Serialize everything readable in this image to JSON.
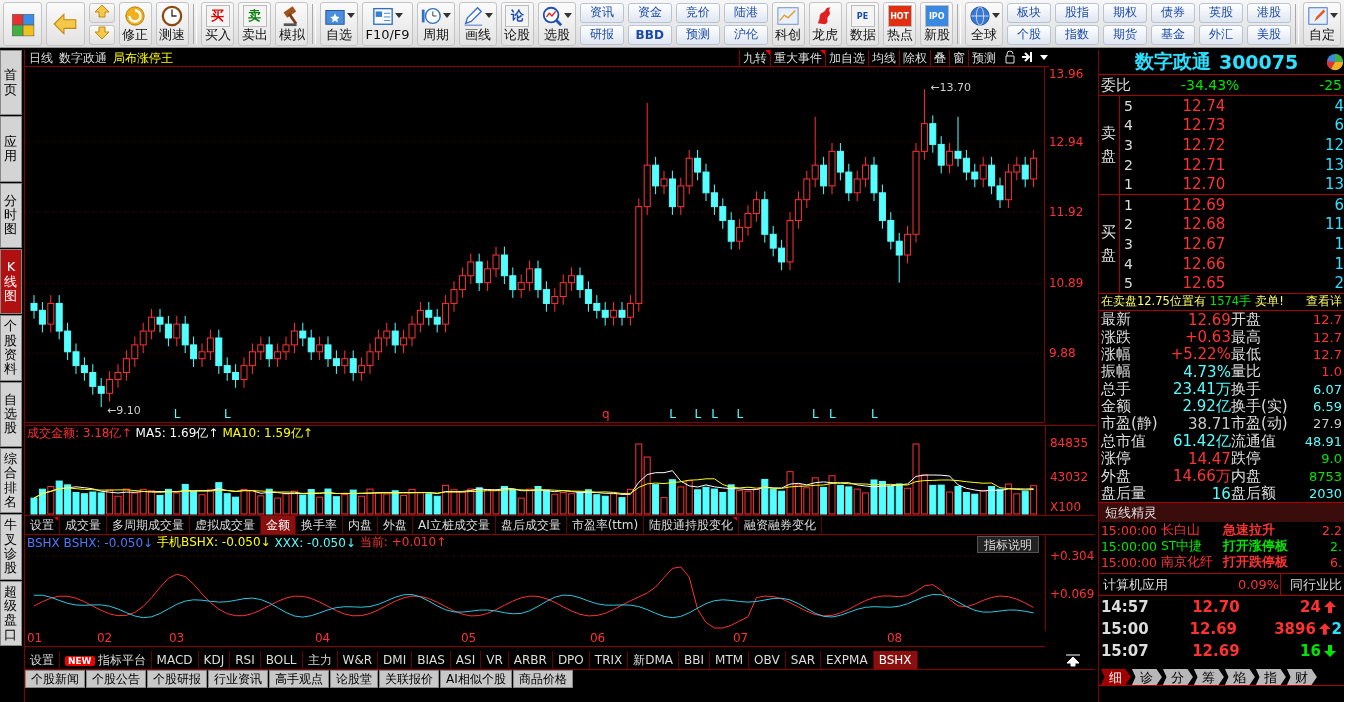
{
  "toolbar": [
    {
      "kind": "big",
      "dropdown": false
    },
    {
      "kind": "big",
      "dropdown": false
    },
    {
      "kind": "updown"
    },
    {
      "kind": "big",
      "label": "修正",
      "dropdown": false
    },
    {
      "kind": "big",
      "label": "测速",
      "dropdown": false
    },
    {
      "kind": "sep"
    },
    {
      "kind": "big",
      "label": "买入",
      "glyph": "买",
      "dropdown": false
    },
    {
      "kind": "big",
      "label": "卖出",
      "glyph": "卖",
      "dropdown": false
    },
    {
      "kind": "big",
      "label": "模拟",
      "dropdown": false
    },
    {
      "kind": "sep"
    },
    {
      "kind": "big",
      "label": "自选",
      "dropdown": true
    },
    {
      "kind": "big",
      "label": "F10/F9",
      "dropdown": true
    },
    {
      "kind": "big",
      "label": "周期",
      "dropdown": true
    },
    {
      "kind": "big",
      "label": "画线",
      "dropdown": true
    },
    {
      "kind": "big",
      "label": "论股",
      "glyph": "论",
      "dropdown": false
    },
    {
      "kind": "big",
      "label": "选股",
      "dropdown": true
    },
    {
      "kind": "pair",
      "top": "资讯",
      "bottom": "研报"
    },
    {
      "kind": "pair",
      "top": "资金",
      "bottom": "BBD"
    },
    {
      "kind": "pair",
      "top": "竞价",
      "bottom": "预测"
    },
    {
      "kind": "pair",
      "top": "陆港",
      "bottom": "沪伦"
    },
    {
      "kind": "big",
      "label": "科创",
      "dropdown": false
    },
    {
      "kind": "big",
      "label": "龙虎",
      "dropdown": false
    },
    {
      "kind": "big",
      "label": "数据",
      "glyph": "PE",
      "dropdown": false
    },
    {
      "kind": "big",
      "label": "热点",
      "glyph": "HOT",
      "dropdown": false
    },
    {
      "kind": "big",
      "label": "新股",
      "glyph": "IPO",
      "dropdown": false
    },
    {
      "kind": "sep"
    },
    {
      "kind": "big",
      "label": "全球",
      "dropdown": true
    },
    {
      "kind": "pair",
      "top": "板块",
      "bottom": "个股"
    },
    {
      "kind": "pair",
      "top": "股指",
      "bottom": "指数"
    },
    {
      "kind": "pair",
      "top": "期权",
      "bottom": "期货"
    },
    {
      "kind": "pair",
      "top": "债券",
      "bottom": "基金"
    },
    {
      "kind": "pair",
      "top": "英股",
      "bottom": "外汇"
    },
    {
      "kind": "pair",
      "top": "港股",
      "bottom": "美股"
    },
    {
      "kind": "sep"
    },
    {
      "kind": "big",
      "label": "自定",
      "dropdown": true
    }
  ],
  "side_tabs": [
    {
      "label": "首页",
      "selected": false
    },
    {
      "label": "应用",
      "selected": false
    },
    {
      "label": "分时图",
      "selected": false
    },
    {
      "label": "K线图",
      "selected": true
    },
    {
      "label": "个股资料",
      "selected": false
    },
    {
      "label": "自选股",
      "selected": false
    },
    {
      "label": "综合排名",
      "selected": false
    },
    {
      "label": "牛叉诊股",
      "selected": false
    },
    {
      "label": "超级盘口",
      "selected": false
    }
  ],
  "chart_header": {
    "period": "日线",
    "stock": "数字政通",
    "strategy": "局布涨停王",
    "buttons": [
      {
        "label": "九转",
        "flag": true
      },
      {
        "label": "重大事件",
        "flag": true
      },
      {
        "label": "加自选",
        "flag": false
      },
      {
        "label": "均线",
        "flag": false
      },
      {
        "label": "除权",
        "flag": false
      },
      {
        "label": "叠",
        "flag": false
      },
      {
        "label": "窗",
        "flag": false
      },
      {
        "label": "预测",
        "flag": false
      }
    ]
  },
  "kline": {
    "chart_data": {
      "type": "candlestick",
      "ylim": [
        8.87,
        14.02
      ],
      "grid": true,
      "yticks": [
        13.96,
        12.94,
        11.92,
        10.89,
        9.88
      ],
      "ohlc": [
        [
          10.6,
          10.72,
          10.38,
          10.5
        ],
        [
          10.5,
          10.62,
          10.18,
          10.3
        ],
        [
          10.3,
          10.72,
          10.18,
          10.6
        ],
        [
          10.6,
          10.72,
          10.08,
          10.2
        ],
        [
          10.2,
          10.32,
          9.78,
          9.9
        ],
        [
          9.9,
          10.02,
          9.58,
          9.7
        ],
        [
          9.7,
          9.82,
          9.48,
          9.6
        ],
        [
          9.6,
          9.72,
          9.28,
          9.4
        ],
        [
          9.4,
          9.52,
          9.1,
          9.3
        ],
        [
          9.3,
          9.62,
          9.18,
          9.5
        ],
        [
          9.5,
          9.72,
          9.38,
          9.6
        ],
        [
          9.6,
          9.92,
          9.48,
          9.8
        ],
        [
          9.8,
          10.12,
          9.68,
          10.0
        ],
        [
          10.0,
          10.32,
          9.88,
          10.2
        ],
        [
          10.2,
          10.52,
          10.08,
          10.4
        ],
        [
          10.4,
          10.52,
          10.18,
          10.3
        ],
        [
          10.3,
          10.42,
          9.98,
          10.1
        ],
        [
          10.1,
          10.42,
          9.98,
          10.3
        ],
        [
          10.3,
          10.42,
          9.88,
          10.0
        ],
        [
          10.0,
          10.12,
          9.68,
          9.8
        ],
        [
          9.8,
          10.02,
          9.68,
          9.9
        ],
        [
          9.9,
          10.22,
          9.78,
          10.1
        ],
        [
          10.1,
          10.22,
          9.58,
          9.7
        ],
        [
          9.7,
          9.82,
          9.48,
          9.6
        ],
        [
          9.6,
          9.72,
          9.38,
          9.5
        ],
        [
          9.5,
          9.82,
          9.38,
          9.7
        ],
        [
          9.7,
          10.02,
          9.58,
          9.9
        ],
        [
          9.9,
          10.12,
          9.78,
          10.0
        ],
        [
          10.0,
          10.12,
          9.68,
          9.8
        ],
        [
          9.8,
          10.02,
          9.68,
          9.9
        ],
        [
          9.9,
          10.12,
          9.78,
          10.0
        ],
        [
          10.0,
          10.32,
          9.88,
          10.2
        ],
        [
          10.2,
          10.32,
          9.98,
          10.1
        ],
        [
          10.1,
          10.22,
          9.78,
          9.9
        ],
        [
          9.9,
          10.12,
          9.78,
          10.0
        ],
        [
          10.0,
          10.12,
          9.68,
          9.8
        ],
        [
          9.8,
          9.92,
          9.58,
          9.7
        ],
        [
          9.7,
          9.92,
          9.58,
          9.8
        ],
        [
          9.8,
          9.92,
          9.48,
          9.6
        ],
        [
          9.6,
          9.82,
          9.48,
          9.7
        ],
        [
          9.7,
          10.02,
          9.58,
          9.9
        ],
        [
          9.9,
          10.22,
          9.78,
          10.1
        ],
        [
          10.1,
          10.32,
          9.98,
          10.2
        ],
        [
          10.2,
          10.32,
          9.88,
          10.0
        ],
        [
          10.0,
          10.22,
          9.88,
          10.1
        ],
        [
          10.1,
          10.42,
          9.98,
          10.3
        ],
        [
          10.3,
          10.62,
          10.18,
          10.5
        ],
        [
          10.5,
          10.62,
          10.28,
          10.4
        ],
        [
          10.4,
          10.52,
          10.18,
          10.3
        ],
        [
          10.3,
          10.72,
          10.18,
          10.6
        ],
        [
          10.6,
          10.92,
          10.48,
          10.8
        ],
        [
          10.8,
          11.12,
          10.68,
          11.0
        ],
        [
          11.0,
          11.32,
          10.88,
          11.2
        ],
        [
          11.2,
          11.32,
          10.78,
          10.9
        ],
        [
          10.9,
          11.22,
          10.78,
          11.1
        ],
        [
          11.1,
          11.42,
          10.98,
          11.3
        ],
        [
          11.3,
          11.42,
          10.88,
          11.0
        ],
        [
          11.0,
          11.12,
          10.68,
          10.8
        ],
        [
          10.8,
          11.02,
          10.68,
          10.9
        ],
        [
          10.9,
          11.22,
          10.78,
          11.1
        ],
        [
          11.1,
          11.22,
          10.68,
          10.8
        ],
        [
          10.8,
          10.92,
          10.48,
          10.6
        ],
        [
          10.6,
          10.82,
          10.48,
          10.7
        ],
        [
          10.7,
          11.02,
          10.58,
          10.9
        ],
        [
          10.9,
          11.12,
          10.78,
          11.0
        ],
        [
          11.0,
          11.12,
          10.68,
          10.8
        ],
        [
          10.8,
          10.92,
          10.48,
          10.6
        ],
        [
          10.6,
          10.72,
          10.38,
          10.5
        ],
        [
          10.5,
          10.62,
          10.28,
          10.4
        ],
        [
          10.4,
          10.62,
          10.28,
          10.5
        ],
        [
          10.5,
          10.62,
          10.28,
          10.4
        ],
        [
          10.4,
          10.72,
          10.28,
          10.6
        ],
        [
          10.6,
          12.12,
          10.48,
          12.0
        ],
        [
          12.0,
          13.5,
          11.88,
          12.6
        ],
        [
          12.6,
          12.72,
          12.18,
          12.3
        ],
        [
          12.3,
          12.52,
          12.18,
          12.4
        ],
        [
          12.4,
          12.52,
          11.88,
          12.0
        ],
        [
          12.0,
          12.42,
          11.88,
          12.3
        ],
        [
          12.3,
          12.82,
          12.18,
          12.7
        ],
        [
          12.7,
          12.82,
          12.38,
          12.5
        ],
        [
          12.5,
          12.62,
          12.08,
          12.2
        ],
        [
          12.2,
          12.32,
          11.88,
          12.0
        ],
        [
          12.0,
          12.12,
          11.68,
          11.8
        ],
        [
          11.8,
          11.92,
          11.38,
          11.5
        ],
        [
          11.5,
          11.82,
          11.38,
          11.7
        ],
        [
          11.7,
          12.02,
          11.58,
          11.9
        ],
        [
          11.9,
          12.22,
          11.78,
          12.1
        ],
        [
          12.1,
          12.22,
          11.48,
          11.6
        ],
        [
          11.6,
          11.72,
          11.28,
          11.4
        ],
        [
          11.4,
          11.52,
          11.08,
          11.2
        ],
        [
          11.2,
          11.92,
          11.08,
          11.8
        ],
        [
          11.8,
          12.22,
          11.68,
          12.1
        ],
        [
          12.1,
          12.52,
          11.98,
          12.4
        ],
        [
          12.4,
          13.3,
          12.28,
          12.6
        ],
        [
          12.6,
          12.72,
          12.18,
          12.3
        ],
        [
          12.3,
          12.92,
          12.18,
          12.8
        ],
        [
          12.8,
          12.92,
          12.38,
          12.5
        ],
        [
          12.5,
          12.62,
          12.08,
          12.2
        ],
        [
          12.2,
          12.52,
          12.08,
          12.4
        ],
        [
          12.4,
          12.72,
          12.28,
          12.6
        ],
        [
          12.6,
          12.72,
          12.08,
          12.2
        ],
        [
          12.2,
          12.32,
          11.68,
          11.8
        ],
        [
          11.8,
          11.92,
          11.38,
          11.5
        ],
        [
          11.5,
          11.62,
          10.9,
          11.3
        ],
        [
          11.3,
          11.72,
          11.18,
          11.6
        ],
        [
          11.6,
          12.92,
          11.48,
          12.8
        ],
        [
          12.8,
          13.7,
          12.68,
          13.2
        ],
        [
          13.2,
          13.32,
          12.78,
          12.9
        ],
        [
          12.9,
          13.02,
          12.48,
          12.6
        ],
        [
          12.6,
          12.92,
          12.48,
          12.8
        ],
        [
          12.8,
          13.3,
          12.58,
          12.7
        ],
        [
          12.7,
          12.82,
          12.38,
          12.5
        ],
        [
          12.5,
          12.62,
          12.28,
          12.4
        ],
        [
          12.4,
          12.72,
          12.28,
          12.6
        ],
        [
          12.6,
          12.72,
          12.18,
          12.3
        ],
        [
          12.3,
          12.42,
          11.98,
          12.1
        ],
        [
          12.1,
          12.62,
          11.98,
          12.5
        ],
        [
          12.5,
          12.72,
          12.38,
          12.6
        ],
        [
          12.6,
          12.72,
          12.28,
          12.4
        ],
        [
          12.4,
          12.82,
          12.28,
          12.7
        ]
      ]
    },
    "high_label": "←13.70",
    "low_label": "←9.10",
    "signals": [
      "L",
      "L",
      "q",
      "L",
      "L",
      "L",
      "L",
      "L",
      "L",
      "L"
    ]
  },
  "volume": {
    "legend": [
      {
        "text": "成交金额: 3.18亿↑",
        "color": "#ff3232"
      },
      {
        "text": "MA5: 1.69亿↑",
        "color": "#ffffff"
      },
      {
        "text": "MA10: 1.59亿↑",
        "color": "#ffff00"
      }
    ],
    "ticks": [
      "84835",
      "43032",
      "X100"
    ]
  },
  "volume_tabs": [
    {
      "label": "设置",
      "flag": true,
      "selected": false
    },
    {
      "label": "成交量",
      "flag": false,
      "selected": false
    },
    {
      "label": "多周期成交量",
      "flag": false,
      "selected": false
    },
    {
      "label": "虚拟成交量",
      "flag": false,
      "selected": false
    },
    {
      "label": "金额",
      "flag": false,
      "selected": true
    },
    {
      "label": "换手率",
      "flag": false,
      "selected": false
    },
    {
      "label": "内盘",
      "flag": false,
      "selected": false
    },
    {
      "label": "外盘",
      "flag": false,
      "selected": false
    },
    {
      "label": "AI立桩成交量",
      "flag": false,
      "selected": false
    },
    {
      "label": "盘后成交量",
      "flag": false,
      "selected": false
    },
    {
      "label": "市盈率(ttm)",
      "flag": false,
      "selected": false
    },
    {
      "label": "陆股通持股变化",
      "flag": true,
      "selected": false
    },
    {
      "label": "融资融券变化",
      "flag": false,
      "selected": false
    }
  ],
  "indicator": {
    "legend": [
      {
        "text": "BSHX BSHX: -0.050↓",
        "color": "#4a7bff"
      },
      {
        "text": "手机BSHX: -0.050↓",
        "color": "#ffff00"
      },
      {
        "text": "XXX: -0.050↓",
        "color": "#54ffff"
      },
      {
        "text": "当前: +0.010↑",
        "color": "#ff3232"
      }
    ],
    "help_button": "指标说明",
    "ticks": [
      "+0.304",
      "+0.069"
    ],
    "months": [
      "01",
      "02",
      "03",
      "04",
      "05",
      "06",
      "07",
      "08"
    ]
  },
  "indicator_tabs": [
    {
      "label": "设置",
      "selected": false
    },
    {
      "label": "指标平台",
      "badge": "NEW",
      "selected": false
    },
    {
      "label": "MACD",
      "selected": false
    },
    {
      "label": "KDJ",
      "selected": false
    },
    {
      "label": "RSI",
      "selected": false
    },
    {
      "label": "BOLL",
      "selected": false
    },
    {
      "label": "主力",
      "selected": false
    },
    {
      "label": "W&R",
      "selected": false
    },
    {
      "label": "DMI",
      "selected": false
    },
    {
      "label": "BIAS",
      "selected": false
    },
    {
      "label": "ASI",
      "selected": false
    },
    {
      "label": "VR",
      "selected": false
    },
    {
      "label": "ARBR",
      "selected": false
    },
    {
      "label": "DPO",
      "selected": false
    },
    {
      "label": "TRIX",
      "selected": false
    },
    {
      "label": "新DMA",
      "selected": false
    },
    {
      "label": "BBI",
      "selected": false
    },
    {
      "label": "MTM",
      "selected": false
    },
    {
      "label": "OBV",
      "selected": false
    },
    {
      "label": "SAR",
      "selected": false
    },
    {
      "label": "EXPMA",
      "selected": false
    },
    {
      "label": "BSHX",
      "selected": true
    }
  ],
  "news_tabs": [
    "个股新闻",
    "个股公告",
    "个股研报",
    "行业资讯",
    "高手观点",
    "论股堂",
    "关联报价",
    "AI相似个股",
    "商品价格"
  ],
  "quote": {
    "name": "数字政通",
    "code": "300075",
    "ratio": {
      "label": "委比",
      "value": "-34.43%",
      "diff": "-25"
    },
    "sell_label": "卖盘",
    "buy_label": "买盘",
    "sell": [
      {
        "level": "5",
        "price": "12.74",
        "volume": "4"
      },
      {
        "level": "4",
        "price": "12.73",
        "volume": "6"
      },
      {
        "level": "3",
        "price": "12.72",
        "volume": "12"
      },
      {
        "level": "2",
        "price": "12.71",
        "volume": "13"
      },
      {
        "level": "1",
        "price": "12.70",
        "volume": "13"
      }
    ],
    "buy": [
      {
        "level": "1",
        "price": "12.69",
        "volume": "6"
      },
      {
        "level": "2",
        "price": "12.68",
        "volume": "11"
      },
      {
        "level": "3",
        "price": "12.67",
        "volume": "1"
      },
      {
        "level": "4",
        "price": "12.66",
        "volume": "1"
      },
      {
        "level": "5",
        "price": "12.65",
        "volume": "2"
      }
    ],
    "notice": {
      "text": "在卖盘12.75位置有",
      "amount": "1574手",
      "suffix": "卖单!",
      "link": "查看详"
    },
    "stats": [
      {
        "label": "最新",
        "value": "12.69",
        "color": "#ff3232"
      },
      {
        "label": "开盘",
        "value": "12.7",
        "color": "#ff3232"
      },
      {
        "label": "涨跌",
        "value": "+0.63",
        "color": "#ff3232"
      },
      {
        "label": "最高",
        "value": "12.7",
        "color": "#ff3232"
      },
      {
        "label": "涨幅",
        "value": "+5.22%",
        "color": "#ff3232"
      },
      {
        "label": "最低",
        "value": "12.7",
        "color": "#ff3232"
      },
      {
        "label": "振幅",
        "value": "4.73%",
        "color": "#54ffff"
      },
      {
        "label": "量比",
        "value": "1.0",
        "color": "#ff3232"
      },
      {
        "label": "总手",
        "value": "23.41万",
        "color": "#54ffff"
      },
      {
        "label": "换手",
        "value": "6.07",
        "color": "#54ffff"
      },
      {
        "label": "金额",
        "value": "2.92亿",
        "color": "#54ffff"
      },
      {
        "label": "换手(实)",
        "value": "6.59",
        "color": "#54ffff"
      },
      {
        "label": "市盈(静)",
        "value": "38.71",
        "color": "#c8c8c8"
      },
      {
        "label": "市盈(动)",
        "value": "27.9",
        "color": "#c8c8c8"
      },
      {
        "label": "总市值",
        "value": "61.42亿",
        "color": "#54ffff"
      },
      {
        "label": "流通值",
        "value": "48.91",
        "color": "#54ffff"
      },
      {
        "label": "涨停",
        "value": "14.47",
        "color": "#ff3232"
      },
      {
        "label": "跌停",
        "value": "9.0",
        "color": "#00e600"
      },
      {
        "label": "外盘",
        "value": "14.66万",
        "color": "#ff3232"
      },
      {
        "label": "内盘",
        "value": "8753",
        "color": "#00e600"
      },
      {
        "label": "盘后量",
        "value": "16",
        "color": "#54ffff"
      },
      {
        "label": "盘后额",
        "value": "2030",
        "color": "#54ffff"
      }
    ],
    "alerts_title": "短线精灵",
    "alerts": [
      {
        "time": "15:00:00",
        "stock": "长白山",
        "event": "急速拉升",
        "value": "2.2",
        "color": "#ff3232"
      },
      {
        "time": "15:00:00",
        "stock": "ST中捷",
        "event": "打开涨停板",
        "value": "2.",
        "color": "#00e600"
      },
      {
        "time": "15:00:00",
        "stock": "南京化纤",
        "event": "打开跌停板",
        "value": "6.",
        "color": "#ff3232"
      }
    ],
    "industry": {
      "name": "计算机应用",
      "change": "0.09%",
      "button": "同行业比"
    },
    "ticks": [
      {
        "time": "14:57",
        "price": "12.70",
        "volume": "24",
        "rising": true
      },
      {
        "time": "15:00",
        "price": "12.69",
        "volume": "3896",
        "rising": true,
        "extra": "2"
      },
      {
        "time": "15:07",
        "price": "12.69",
        "volume": "16",
        "rising": false
      }
    ],
    "tabs": [
      {
        "label": "细",
        "selected": true
      },
      {
        "label": "诊",
        "selected": false
      },
      {
        "label": "分",
        "selected": false
      },
      {
        "label": "筹",
        "selected": false
      },
      {
        "label": "焰",
        "selected": false
      },
      {
        "label": "指",
        "selected": false
      },
      {
        "label": "财",
        "selected": false
      }
    ]
  }
}
